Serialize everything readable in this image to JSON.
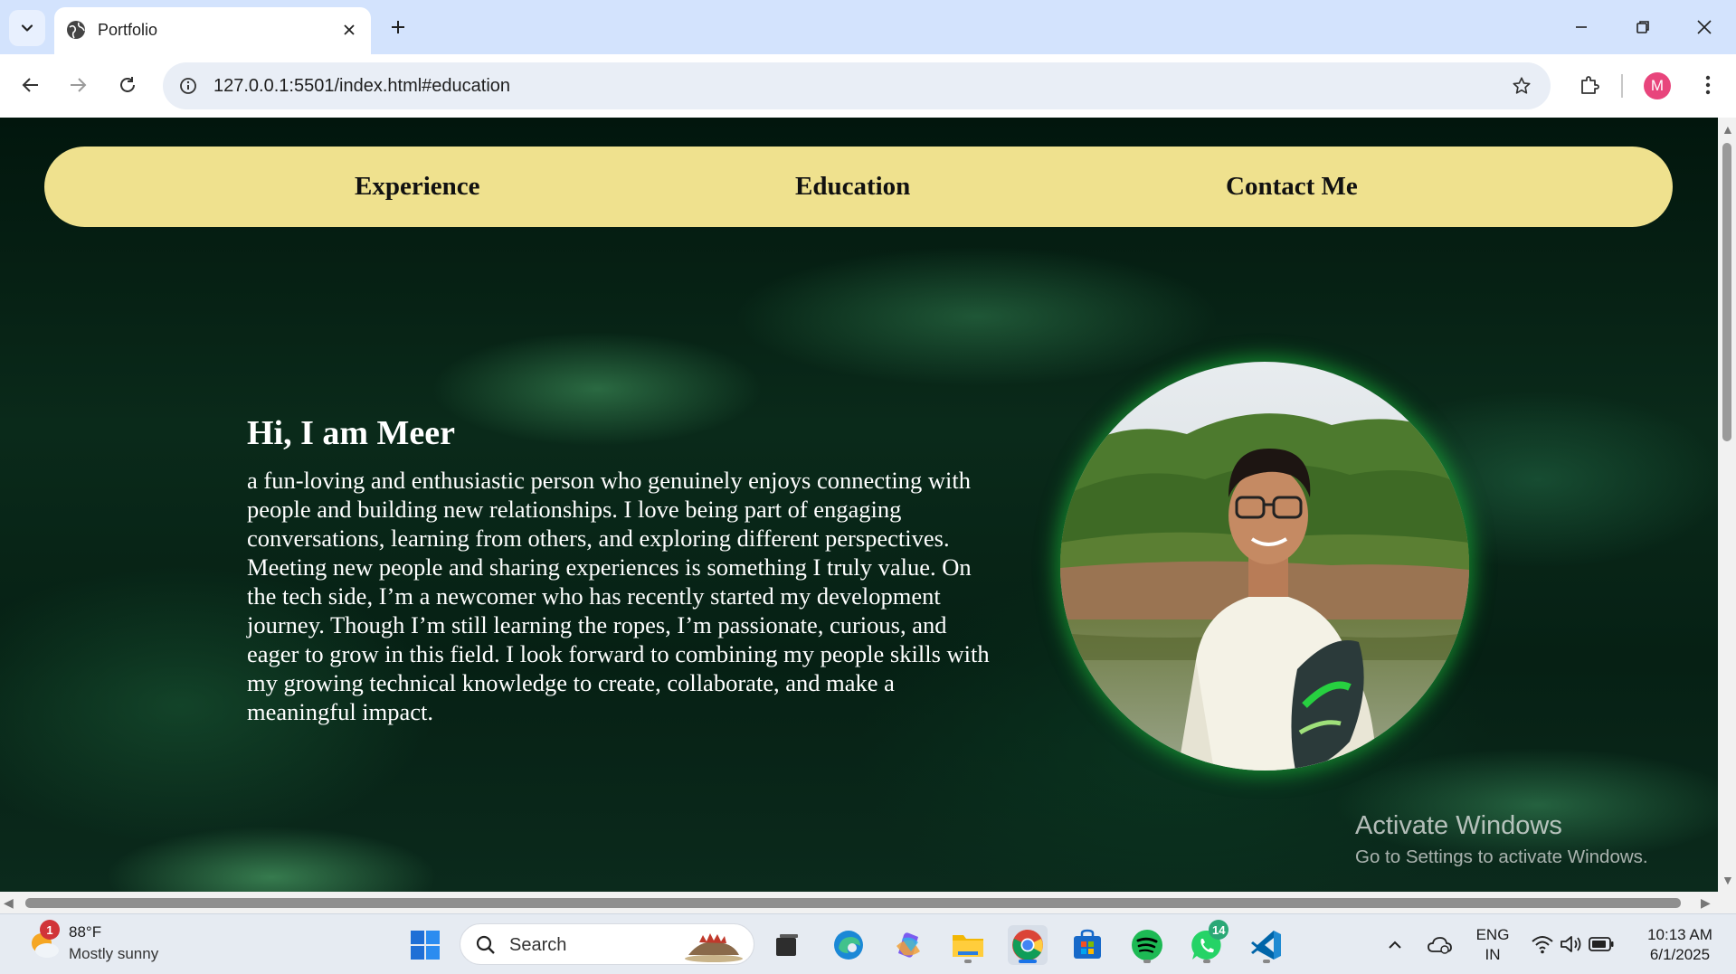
{
  "browser": {
    "tab_title": "Portfolio",
    "url": "127.0.0.1:5501/index.html#education",
    "profile_initial": "M"
  },
  "page": {
    "nav": {
      "items": [
        {
          "label": "Experience"
        },
        {
          "label": "Education"
        },
        {
          "label": "Contact Me"
        }
      ]
    },
    "hero": {
      "title": "Hi, I am Meer",
      "description": "a fun-loving and enthusiastic person who genuinely enjoys connecting with people and building new relationships. I love being part of engaging conversations, learning from others, and exploring different perspectives. Meeting new people and sharing experiences is something I truly value. On the tech side, I’m a newcomer who has recently started my development journey. Though I’m still learning the ropes, I’m passionate, curious, and eager to grow in this field. I look forward to combining my people skills with my growing technical knowledge to create, collaborate, and make a meaningful impact."
    },
    "colors": {
      "navbar_bg": "#efe18e",
      "photo_glow": "#1ec83c",
      "page_bg": "#0a2a1a"
    }
  },
  "watermark": {
    "title": "Activate Windows",
    "subtitle": "Go to Settings to activate Windows."
  },
  "taskbar": {
    "weather": {
      "temp": "88°F",
      "condition": "Mostly sunny",
      "badge": "1"
    },
    "search_placeholder": "Search",
    "whatsapp_badge": "14",
    "language": {
      "line1": "ENG",
      "line2": "IN"
    },
    "clock": {
      "time": "10:13 AM",
      "date": "6/1/2025"
    }
  }
}
